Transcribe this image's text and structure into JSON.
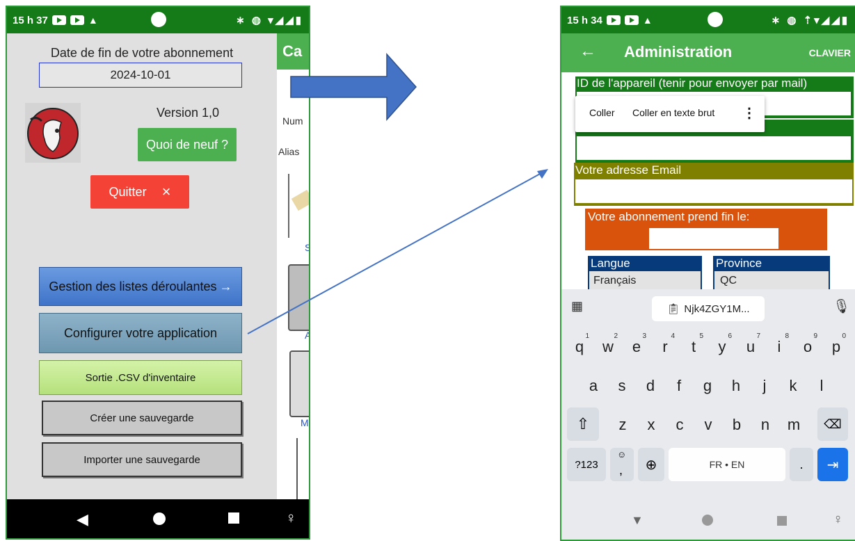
{
  "left_phone": {
    "status": {
      "time": "15 h 37"
    },
    "end_label": "Date de fin de votre abonnement",
    "end_date": "2024-10-01",
    "version": "Version 1,0",
    "whats_new": "Quoi de neuf ?",
    "quit": "Quitter",
    "quit_icon": "×",
    "menu": {
      "lists": "Gestion des listes déroulantes",
      "lists_arrow": "→",
      "config": "Configurer votre application",
      "csv": "Sortie .CSV d'inventaire",
      "backup": "Créer une sauvegarde",
      "import": "Importer une sauvegarde"
    },
    "behind": {
      "title": "Ca",
      "num": "Num",
      "alias": "Alias",
      "s": "S",
      "a": "A",
      "m": "M"
    }
  },
  "right_phone": {
    "status": {
      "time": "15 h 34"
    },
    "title": "Administration",
    "keyboard_btn": "CLAVIER",
    "device_id_label": "ID de l'appareil (tenir pour envoyer par mail)",
    "context_menu": {
      "paste": "Coller",
      "paste_plain": "Coller en texte brut"
    },
    "email_label": "Votre adresse Email",
    "subscription_label": "Votre abonnement prend fin le:",
    "language_label": "Langue",
    "language_value": "Français",
    "province_label": "Province",
    "province_value": "QC",
    "clipboard": "Njk4ZGY1M...",
    "keyboard": {
      "row1": [
        {
          "k": "q",
          "n": "1"
        },
        {
          "k": "w",
          "n": "2"
        },
        {
          "k": "e",
          "n": "3"
        },
        {
          "k": "r",
          "n": "4"
        },
        {
          "k": "t",
          "n": "5"
        },
        {
          "k": "y",
          "n": "6"
        },
        {
          "k": "u",
          "n": "7"
        },
        {
          "k": "i",
          "n": "8"
        },
        {
          "k": "o",
          "n": "9"
        },
        {
          "k": "p",
          "n": "0"
        }
      ],
      "row2": [
        "a",
        "s",
        "d",
        "f",
        "g",
        "h",
        "j",
        "k",
        "l"
      ],
      "row3": [
        "z",
        "x",
        "c",
        "v",
        "b",
        "n",
        "m"
      ],
      "sym": "?123",
      "comma": ",",
      "space": "FR • EN",
      "period": "."
    }
  },
  "colors": {
    "green": "#157a18",
    "appbar": "#4caf50",
    "orange": "#d9530c",
    "olive": "#7f7f00",
    "navy": "#063a7a",
    "arrow": "#4472c4"
  }
}
